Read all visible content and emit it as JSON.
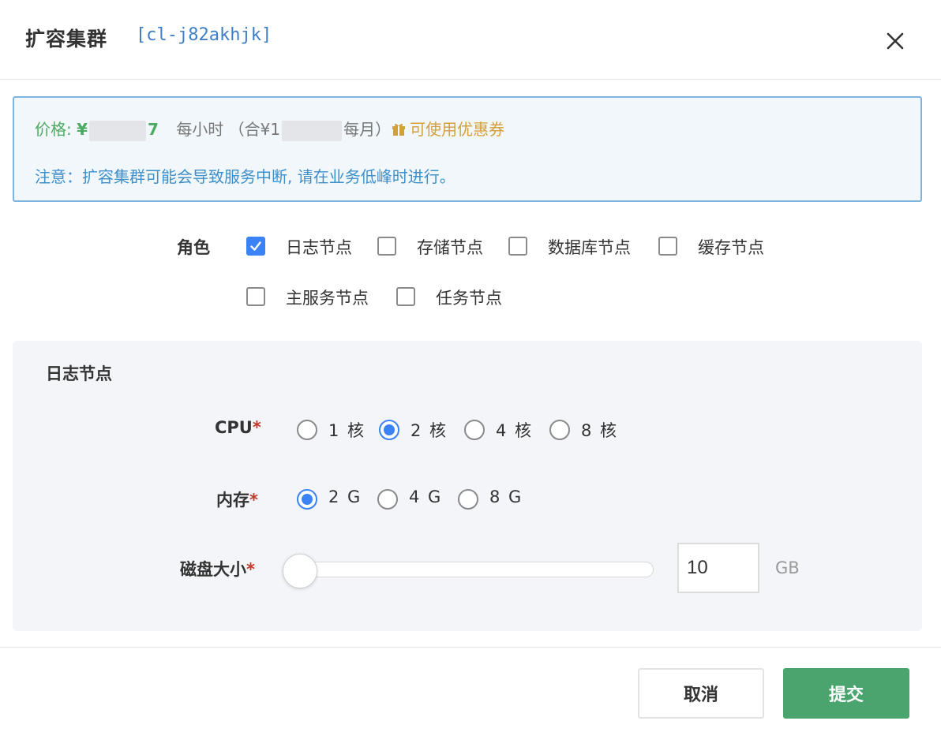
{
  "dialog": {
    "title": "扩容集群",
    "cluster_id": "[cl-j82akhjk]"
  },
  "notice": {
    "price_label": "价格:",
    "currency": "¥",
    "price_tail": "7",
    "unit": "每小时",
    "monthly_prefix": "（合¥1",
    "monthly_suffix": "每月）",
    "coupon": "可使用优惠券",
    "warning": "注意：扩容集群可能会导致服务中断, 请在业务低峰时进行。"
  },
  "roles": {
    "label": "角色",
    "items": [
      {
        "label": "日志节点",
        "checked": true
      },
      {
        "label": "存储节点",
        "checked": false
      },
      {
        "label": "数据库节点",
        "checked": false
      },
      {
        "label": "缓存节点",
        "checked": false
      },
      {
        "label": "主服务节点",
        "checked": false
      },
      {
        "label": "任务节点",
        "checked": false
      }
    ]
  },
  "panel": {
    "title": "日志节点",
    "cpu": {
      "label": "CPU",
      "required": "*",
      "options": [
        {
          "label": "1 核",
          "selected": false
        },
        {
          "label": "2 核",
          "selected": true
        },
        {
          "label": "4 核",
          "selected": false
        },
        {
          "label": "8 核",
          "selected": false
        }
      ]
    },
    "memory": {
      "label": "内存",
      "required": "*",
      "options": [
        {
          "label": "2 G",
          "selected": true
        },
        {
          "label": "4 G",
          "selected": false
        },
        {
          "label": "8 G",
          "selected": false
        }
      ]
    },
    "disk": {
      "label": "磁盘大小",
      "required": "*",
      "value": "10",
      "unit": "GB",
      "slider_level": 0
    }
  },
  "footer": {
    "cancel": "取消",
    "submit": "提交"
  },
  "colors": {
    "accent": "#3b82f6",
    "submit": "#4aa46e",
    "price": "#4daa62",
    "coupon": "#d4a03c",
    "notice_border": "#7fb3df"
  }
}
